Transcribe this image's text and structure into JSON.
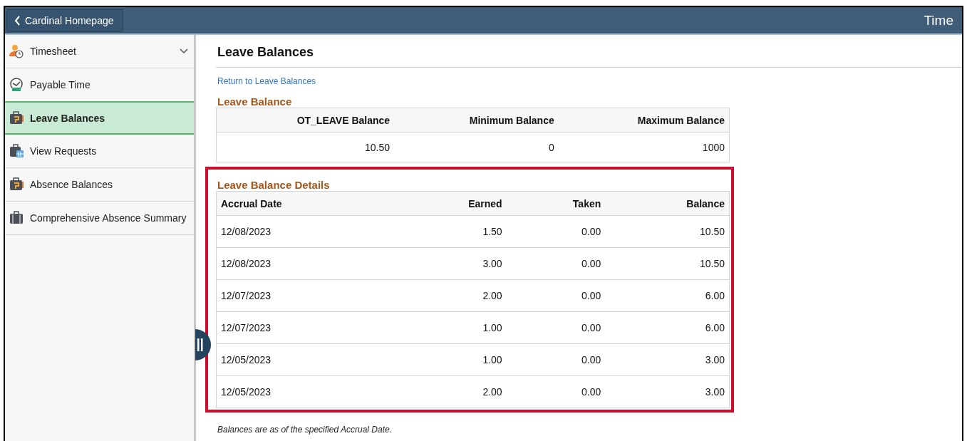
{
  "header": {
    "back_button": "Cardinal Homepage",
    "title": "Time"
  },
  "sidebar": {
    "items": [
      {
        "label": "Timesheet",
        "kind": "person",
        "expanded": false,
        "selected": false
      },
      {
        "label": "Payable Time",
        "kind": "clock",
        "selected": false
      },
      {
        "label": "Leave Balances",
        "kind": "balance",
        "selected": true
      },
      {
        "label": "View Requests",
        "kind": "calendar",
        "selected": false
      },
      {
        "label": "Absence Balances",
        "kind": "balance",
        "selected": false
      },
      {
        "label": "Comprehensive Absence Summary",
        "kind": "case",
        "selected": false
      }
    ]
  },
  "page_title": "Leave Balances",
  "return_link": "Return to Leave Balances",
  "leave_balance": {
    "title": "Leave Balance",
    "columns": [
      "OT_LEAVE Balance",
      "Minimum Balance",
      "Maximum Balance"
    ],
    "rows": [
      [
        "10.50",
        "0",
        "1000"
      ]
    ]
  },
  "details": {
    "title": "Leave Balance Details",
    "highlighted": true,
    "columns": [
      "Accrual Date",
      "Earned",
      "Taken",
      "Balance"
    ],
    "rows": [
      [
        "12/08/2023",
        "1.50",
        "0.00",
        "10.50"
      ],
      [
        "12/08/2023",
        "3.00",
        "0.00",
        "10.50"
      ],
      [
        "12/07/2023",
        "2.00",
        "0.00",
        "6.00"
      ],
      [
        "12/07/2023",
        "1.00",
        "0.00",
        "6.00"
      ],
      [
        "12/05/2023",
        "1.00",
        "0.00",
        "3.00"
      ],
      [
        "12/05/2023",
        "2.00",
        "0.00",
        "3.00"
      ]
    ]
  },
  "footnote": "Balances are as of the specified Accrual Date."
}
